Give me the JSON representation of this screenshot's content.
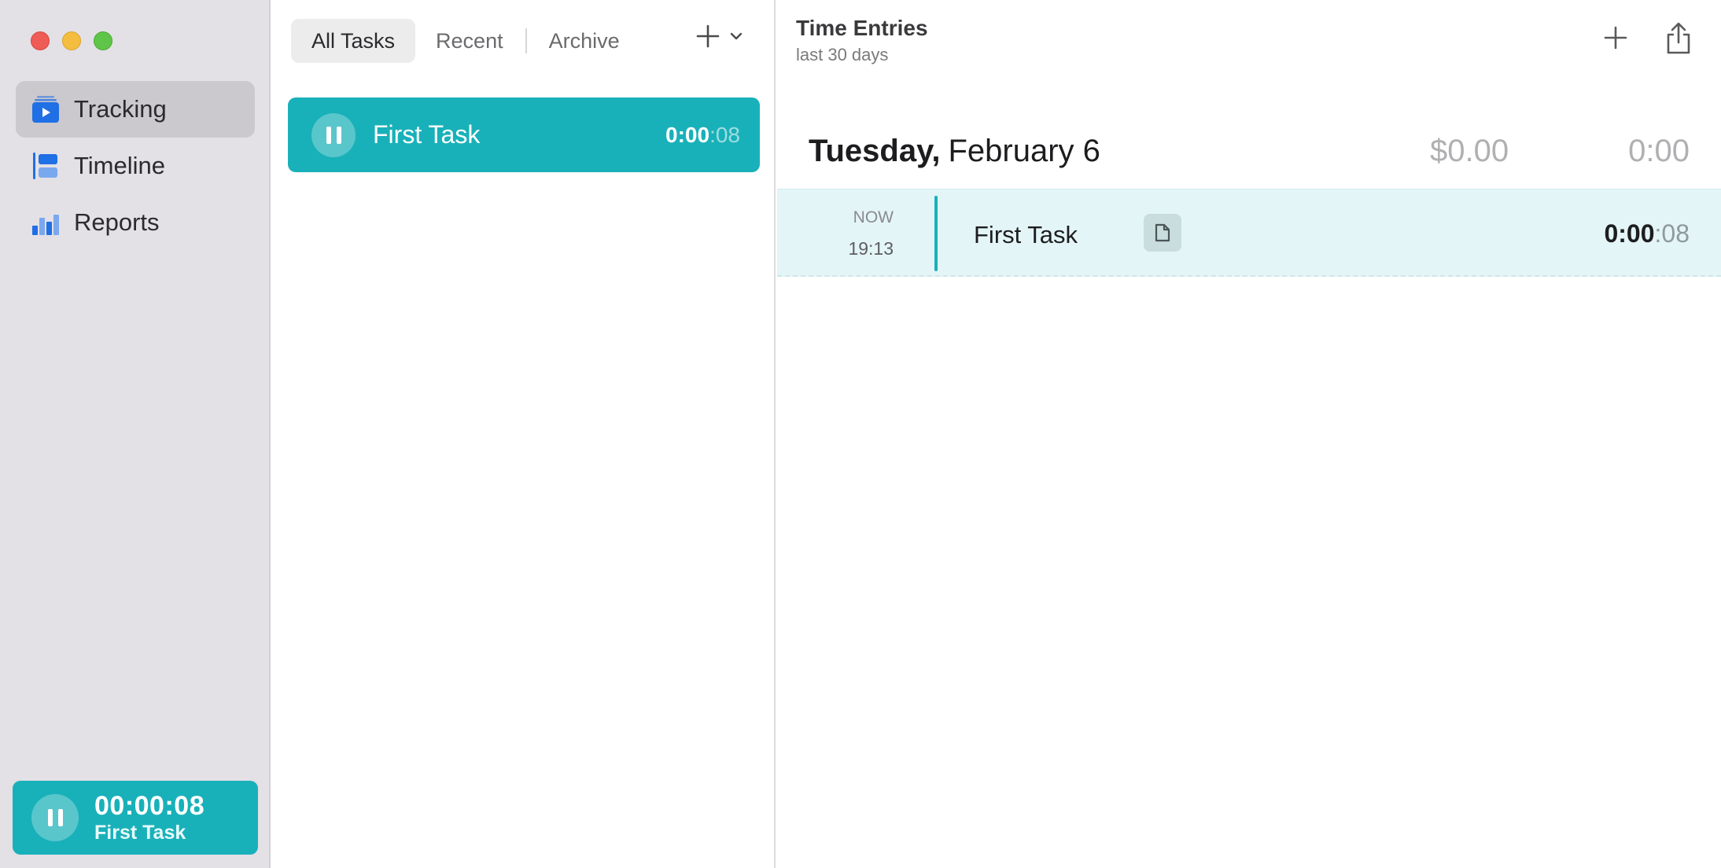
{
  "sidebar": {
    "items": [
      {
        "label": "Tracking",
        "icon": "tracking-icon",
        "active": true
      },
      {
        "label": "Timeline",
        "icon": "timeline-icon",
        "active": false
      },
      {
        "label": "Reports",
        "icon": "reports-icon",
        "active": false
      }
    ],
    "timer": {
      "time": "00:00:08",
      "task": "First Task"
    }
  },
  "tasks": {
    "tabs": [
      {
        "label": "All Tasks",
        "active": true
      },
      {
        "label": "Recent",
        "active": false
      },
      {
        "label": "Archive",
        "active": false
      }
    ],
    "list": [
      {
        "name": "First Task",
        "duration_main": "0:00",
        "duration_sec": ":08",
        "running": true
      }
    ]
  },
  "entries": {
    "title": "Time Entries",
    "subtitle": "last 30 days",
    "day": {
      "weekday": "Tuesday,",
      "date": "February 6",
      "amount": "$0.00",
      "total": "0:00"
    },
    "items": [
      {
        "status": "NOW",
        "start": "19:13",
        "name": "First Task",
        "duration_main": "0:00",
        "duration_sec": ":08"
      }
    ]
  },
  "colors": {
    "accent": "#19b1b9",
    "sidebar_bg": "#e3e0e6",
    "entry_bg": "#e3f5f7",
    "nav_icon_blue": "#1f6fe5"
  }
}
